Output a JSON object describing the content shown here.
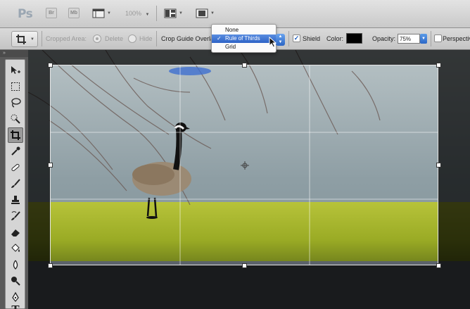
{
  "app": {
    "logo": "Ps",
    "launch_bridge_label": "Br",
    "mini_bridge_label": "Mb",
    "zoom_level": "100%"
  },
  "options_bar": {
    "cropped_area_label": "Cropped Area:",
    "delete_label": "Delete",
    "hide_label": "Hide",
    "overlay_label": "Crop Guide Overlay:",
    "shield_label": "Shield",
    "shield_checked": true,
    "color_label": "Color:",
    "shield_color": "#000000",
    "opacity_label": "Opacity:",
    "opacity_value": "75%",
    "perspective_label": "Perspective",
    "perspective_checked": false
  },
  "overlay_menu": {
    "options": [
      "None",
      "Rule of Thirds",
      "Grid"
    ],
    "selected": "Rule of Thirds",
    "selected_index": 1
  },
  "toolbox": {
    "tools": [
      {
        "name": "move-tool",
        "icon": "move-icon"
      },
      {
        "name": "marquee-tool",
        "icon": "marquee-icon"
      },
      {
        "name": "lasso-tool",
        "icon": "lasso-icon"
      },
      {
        "name": "quick-selection-tool",
        "icon": "quick-selection-icon"
      },
      {
        "name": "crop-tool",
        "icon": "crop-icon",
        "active": true
      },
      {
        "name": "eyedropper-tool",
        "icon": "eyedropper-icon"
      },
      {
        "name": "spot-healing-tool",
        "icon": "bandage-icon"
      },
      {
        "name": "brush-tool",
        "icon": "brush-icon"
      },
      {
        "name": "clone-stamp-tool",
        "icon": "stamp-icon"
      },
      {
        "name": "history-brush-tool",
        "icon": "history-brush-icon"
      },
      {
        "name": "eraser-tool",
        "icon": "eraser-icon"
      },
      {
        "name": "paint-bucket-tool",
        "icon": "paint-bucket-icon"
      },
      {
        "name": "blur-tool",
        "icon": "blur-drop-icon"
      },
      {
        "name": "dodge-tool",
        "icon": "dodge-icon"
      },
      {
        "name": "pen-tool",
        "icon": "pen-icon"
      },
      {
        "name": "type-tool",
        "icon": "type-icon",
        "glyph": "T"
      }
    ]
  },
  "colors": {
    "accent": "#3a74d6",
    "shield_overlay": "rgba(0,0,0,0.75)"
  }
}
